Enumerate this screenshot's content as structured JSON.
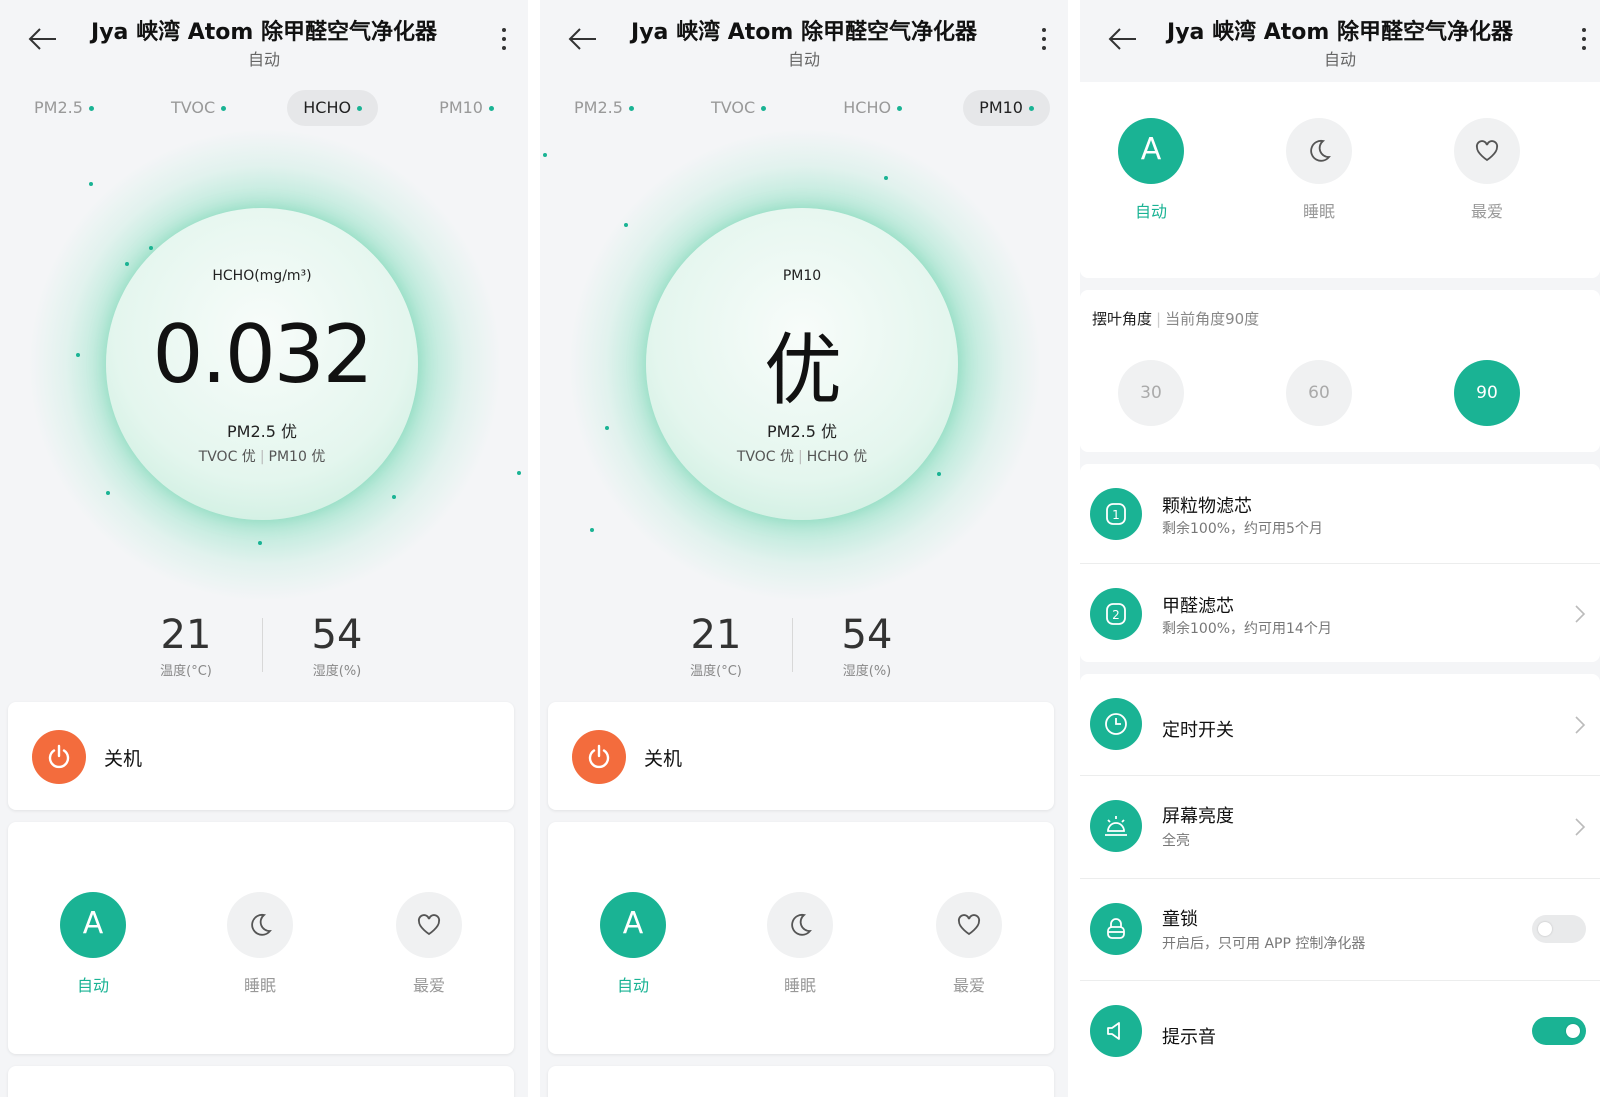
{
  "header": {
    "title": "Jya 峡湾 Atom 除甲醛空气净化器",
    "subtitle": "自动"
  },
  "tabs": [
    "PM2.5",
    "TVOC",
    "HCHO",
    "PM10"
  ],
  "screen1": {
    "active_tab": "HCHO",
    "gauge_label": "HCHO(mg/m³)",
    "gauge_value": "0.032",
    "status": "PM2.5 优",
    "sub_left": "TVOC 优",
    "sub_right": "PM10 优"
  },
  "screen2": {
    "active_tab": "PM10",
    "gauge_label": "PM10",
    "gauge_value": "优",
    "status": "PM2.5 优",
    "sub_left": "TVOC 优",
    "sub_right": "HCHO 优"
  },
  "env": {
    "temperature": "21",
    "temperature_label": "温度(°C)",
    "humidity": "54",
    "humidity_label": "湿度(%)"
  },
  "power": {
    "label": "关机",
    "color": "#f36c3d"
  },
  "modes": {
    "auto": {
      "letter": "A",
      "label": "自动"
    },
    "sleep": {
      "label": "睡眠",
      "icon": "moon-icon"
    },
    "favorite": {
      "label": "最爱",
      "icon": "heart-icon"
    }
  },
  "angle": {
    "title": "摆叶角度",
    "current": "当前角度90度",
    "options": [
      "30",
      "60",
      "90"
    ],
    "selected": "90"
  },
  "filters": [
    {
      "title": "颗粒物滤芯",
      "subtitle": "剩余100%，约可用5个月",
      "icon": "filter-1-icon"
    },
    {
      "title": "甲醛滤芯",
      "subtitle": "剩余100%，约可用14个月",
      "icon": "filter-2-icon"
    }
  ],
  "settings": {
    "timer": {
      "title": "定时开关",
      "icon": "clock-icon"
    },
    "brightness": {
      "title": "屏幕亮度",
      "value": "全亮",
      "icon": "sunrise-icon"
    },
    "child_lock": {
      "title": "童锁",
      "subtitle": "开启后，只可用 APP 控制净化器",
      "enabled": false,
      "icon": "lock-icon"
    },
    "sound": {
      "title": "提示音",
      "enabled": true,
      "icon": "speaker-icon"
    }
  },
  "colors": {
    "accent": "#1ab394",
    "power": "#f36c3d",
    "background": "#f4f5f7"
  }
}
